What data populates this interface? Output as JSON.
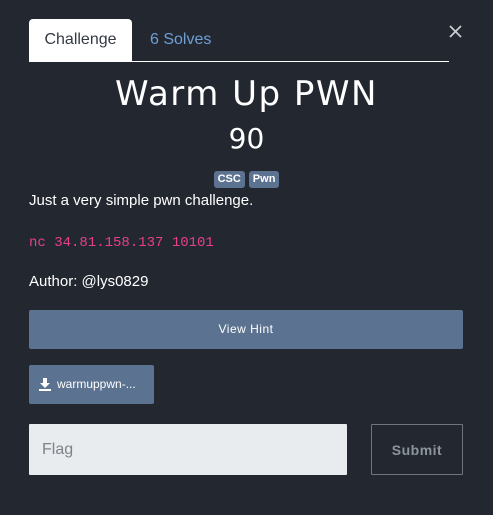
{
  "tabs": {
    "challenge_label": "Challenge",
    "solves_label": "6 Solves"
  },
  "challenge": {
    "name": "Warm Up PWN",
    "value": "90",
    "tags": [
      "CSC",
      "Pwn"
    ],
    "description": "Just a very simple pwn challenge.",
    "connection": "nc 34.81.158.137 10101",
    "author": "Author: @lys0829"
  },
  "actions": {
    "hint_label": "View Hint",
    "file_label": "warmuppwn-...",
    "flag_placeholder": "Flag",
    "flag_value": "",
    "submit_label": "Submit"
  },
  "icons": {
    "close": "close-icon",
    "download": "download-icon"
  },
  "colors": {
    "background": "#232830",
    "accent": "#5b7290",
    "link": "#6e9fd9",
    "code": "#e83e8c"
  }
}
